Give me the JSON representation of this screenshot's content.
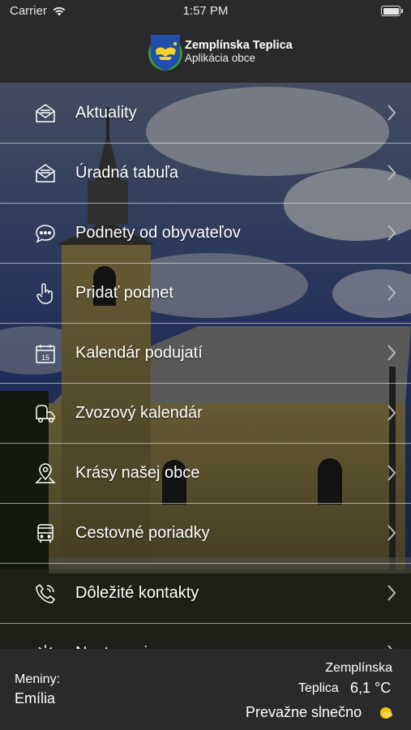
{
  "status_bar": {
    "carrier": "Carrier",
    "time": "1:57 PM"
  },
  "header": {
    "title": "Zemplínska Teplica",
    "subtitle": "Aplikácia obce"
  },
  "menu": {
    "items": [
      {
        "label": "Aktuality",
        "icon": "envelope-icon"
      },
      {
        "label": "Úradná tabuľa",
        "icon": "envelope-icon"
      },
      {
        "label": "Podnety od obyvateľov",
        "icon": "chat-bubble-icon"
      },
      {
        "label": "Pridať podnet",
        "icon": "hand-pointer-icon"
      },
      {
        "label": "Kalendár podujatí",
        "icon": "calendar-icon",
        "badge": "15"
      },
      {
        "label": "Zvozový kalendár",
        "icon": "garbage-truck-icon"
      },
      {
        "label": "Krásy našej obce",
        "icon": "map-pin-icon"
      },
      {
        "label": "Cestovné poriadky",
        "icon": "bus-icon"
      },
      {
        "label": "Dôležité kontakty",
        "icon": "phone-icon"
      },
      {
        "label": "Nastavenia",
        "icon": "gear-icon"
      }
    ]
  },
  "footer": {
    "nameday_label": "Meniny:",
    "nameday_value": "Emília",
    "weather_place_line1": "Zemplínska",
    "weather_place_line2": "Teplica",
    "weather_temp": "6,1 °C",
    "weather_desc": "Prevažne slnečno",
    "weather_icon": "sun-icon"
  },
  "colors": {
    "bar_background": "#2a2a2c",
    "text": "#ffffff",
    "sun": "#f5c400"
  }
}
